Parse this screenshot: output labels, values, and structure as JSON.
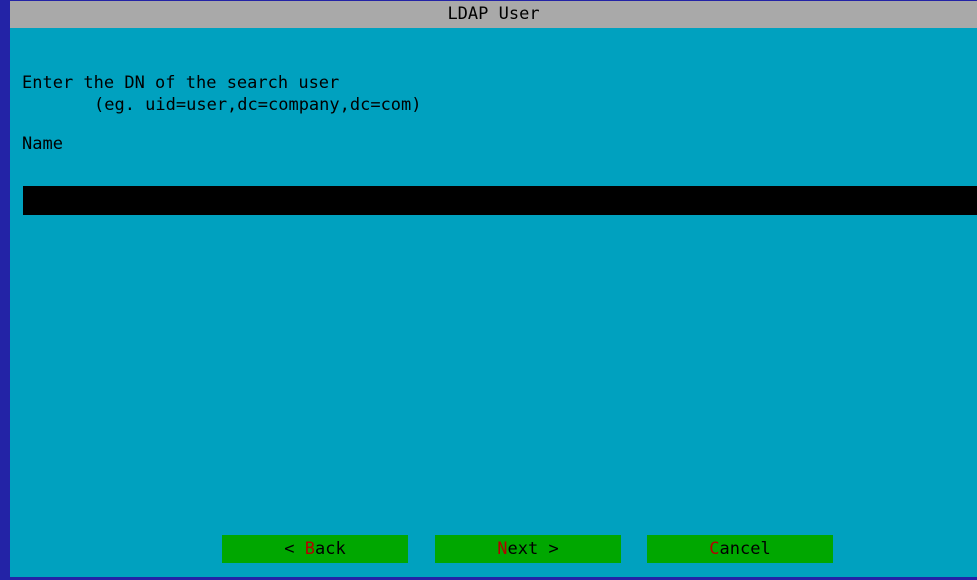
{
  "dialog": {
    "title": "LDAP User",
    "prompt_line1": "Enter the DN of the search user",
    "prompt_line2": "(eg. uid=user,dc=company,dc=com)",
    "field_label": "Name",
    "field_value": ""
  },
  "buttons": {
    "back": {
      "prefix": "< ",
      "hotkey": "B",
      "rest": "ack",
      "suffix": ""
    },
    "next": {
      "prefix": "",
      "hotkey": "N",
      "rest": "ext",
      "suffix": " >"
    },
    "cancel": {
      "prefix": "",
      "hotkey": "C",
      "rest": "ancel",
      "suffix": ""
    }
  },
  "colors": {
    "background": "#00a1bf",
    "titlebar": "#a9a9a9",
    "border": "#2323a6",
    "input": "#000000",
    "button": "#00a700",
    "hotkey": "#b40000"
  }
}
